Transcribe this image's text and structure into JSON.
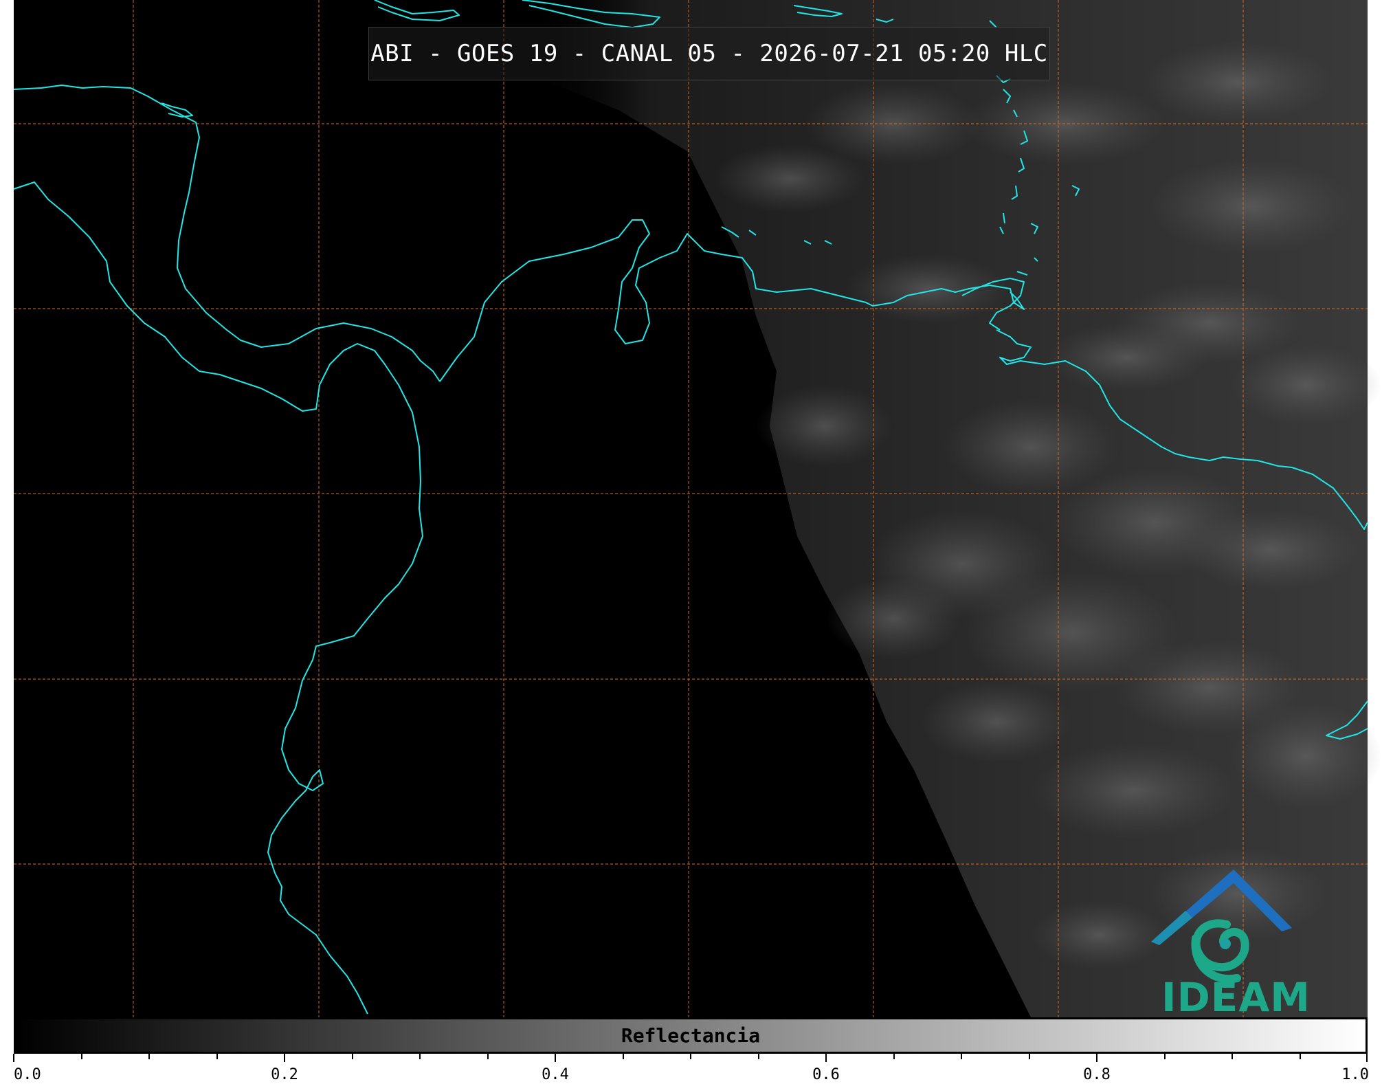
{
  "title": "ABI - GOES 19 - CANAL 05 - 2026-07-21 05:20 HLC",
  "colors": {
    "coastline": "#22e5e5",
    "gridline": "#d46a1e",
    "background": "#000000",
    "logo_blue": "#1f6fc0",
    "logo_green": "#1ea88a"
  },
  "colorbar": {
    "label": "Reflectancia",
    "range": [
      0.0,
      1.0
    ],
    "tick_labels": [
      "0.0",
      "0.2",
      "0.4",
      "0.6",
      "0.8",
      "1.0"
    ]
  },
  "logo": {
    "text": "IDEAM",
    "icon": "ideam-mountain-swirl-icon"
  }
}
